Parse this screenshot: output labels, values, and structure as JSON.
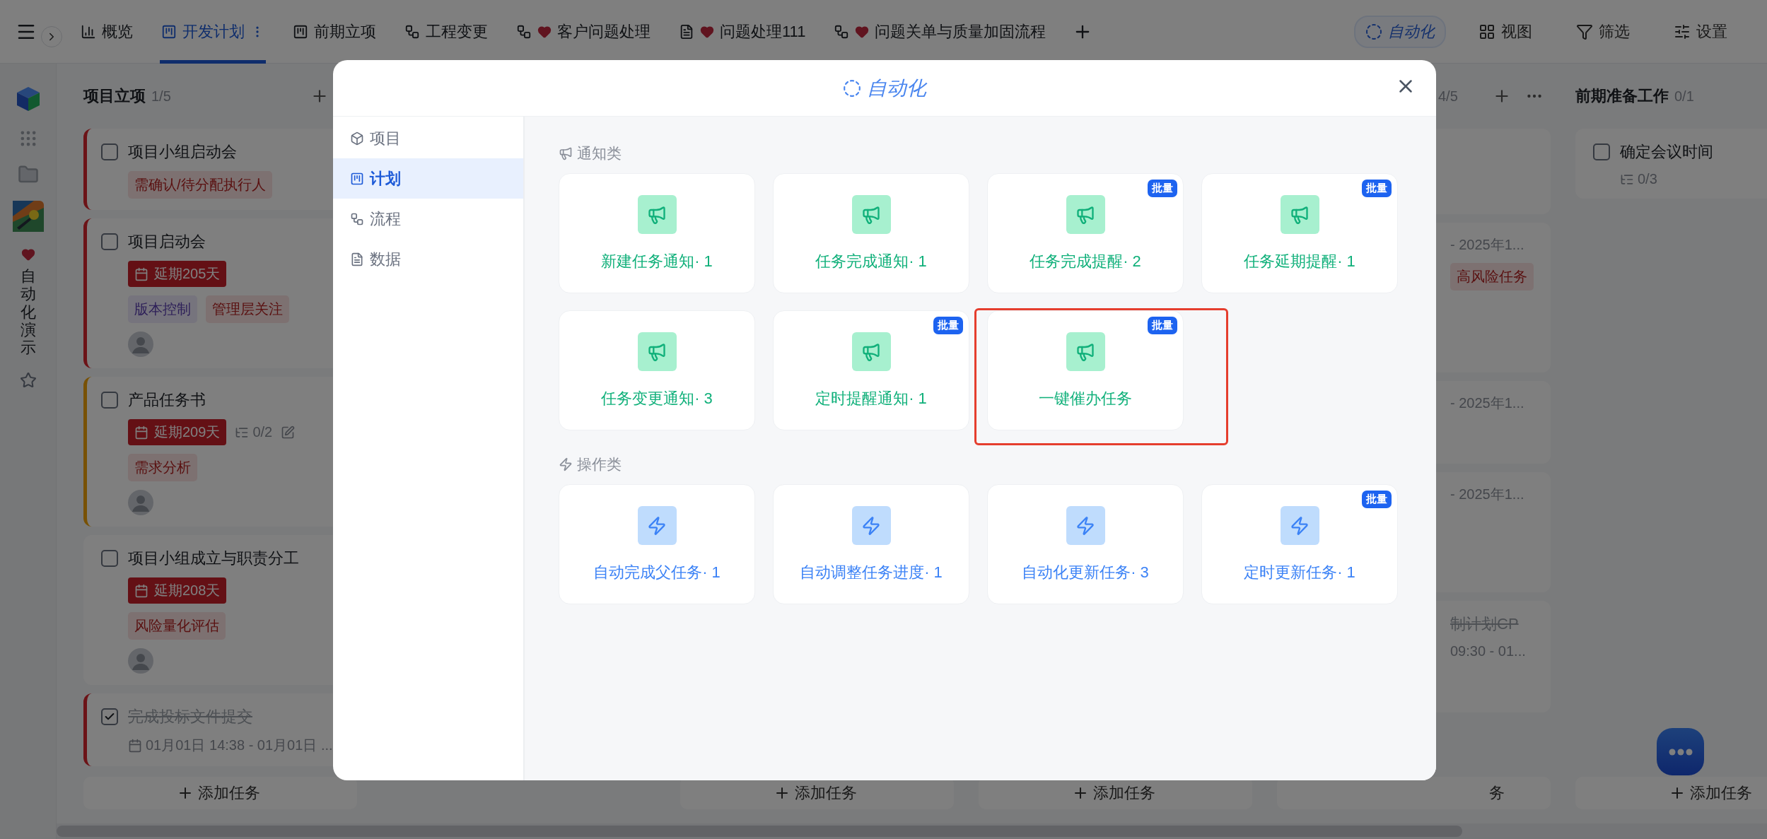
{
  "tabs": [
    {
      "label": "概览",
      "favorite": false,
      "selected": false
    },
    {
      "label": "开发计划",
      "favorite": false,
      "selected": true
    },
    {
      "label": "前期立项",
      "favorite": false,
      "selected": false
    },
    {
      "label": "工程变更",
      "favorite": false,
      "selected": false
    },
    {
      "label": "客户问题处理",
      "favorite": true,
      "selected": false
    },
    {
      "label": "问题处理111",
      "favorite": true,
      "selected": false
    },
    {
      "label": "问题关单与质量加固流程",
      "favorite": true,
      "selected": false
    }
  ],
  "toolbar": [
    {
      "label": "自动化",
      "selected": true
    },
    {
      "label": "视图",
      "selected": false
    },
    {
      "label": "筛选",
      "selected": false
    },
    {
      "label": "设置",
      "selected": false
    }
  ],
  "rail": {
    "app_name": "自动化演示",
    "favorite": true
  },
  "columns": [
    {
      "kind": "full",
      "title": "项目立项",
      "count": "1/5",
      "add_label": "添加任务",
      "cards": [
        {
          "title": "项目小组启动会",
          "kind": "high",
          "done": false,
          "tags": [
            {
              "label": "需确认/待分配执行人",
              "kind": "alert"
            }
          ]
        },
        {
          "title": "项目启动会",
          "kind": "high",
          "done": false,
          "delay": "延期205天",
          "tags": [
            {
              "label": "版本控制",
              "kind": "info"
            },
            {
              "label": "管理层关注",
              "kind": "alert"
            }
          ],
          "avatar": true
        },
        {
          "title": "产品任务书",
          "kind": "medium",
          "done": false,
          "delay": "延期209天",
          "subtasks": "0/2",
          "editable": true,
          "tags": [
            {
              "label": "需求分析",
              "kind": "alert"
            }
          ],
          "avatar": true
        },
        {
          "title": "项目小组成立与职责分工",
          "kind": "plain",
          "done": false,
          "delay": "延期208天",
          "tags": [
            {
              "label": "风险量化评估",
              "kind": "alert"
            }
          ],
          "avatar": true
        },
        {
          "title": "完成投标文件提交",
          "kind": "high",
          "done": true,
          "date": "01月01日 14:38 - 01月01日 ..."
        }
      ]
    },
    {
      "kind": "covered"
    },
    {
      "kind": "covered",
      "add_label": "添加任务"
    },
    {
      "kind": "covered",
      "add_label": "添加任务"
    },
    {
      "kind": "partial",
      "count": "4/5",
      "add_label": "务",
      "cards": [
        {
          "date": "- 2025年1...",
          "tags": [
            {
              "label": "高风险任务",
              "kind": "alert"
            }
          ]
        },
        {
          "date": "- 2025年1..."
        },
        {
          "date": "- 2025年1..."
        },
        {
          "title": "制计划CP",
          "done": true,
          "date": "09:30 - 01..."
        }
      ]
    },
    {
      "kind": "full",
      "title": "前期准备工作",
      "count": "0/1",
      "add_label": "添加任务",
      "cards": [
        {
          "title": "确定会议时间",
          "kind": "plain",
          "done": false,
          "subtasks": "0/3"
        }
      ]
    }
  ],
  "modal": {
    "title": "自动化",
    "nav": [
      {
        "label": "项目",
        "selected": false
      },
      {
        "label": "计划",
        "selected": true
      },
      {
        "label": "流程",
        "selected": false
      },
      {
        "label": "数据",
        "selected": false
      }
    ],
    "sections": [
      {
        "title": "通知类",
        "kind": "notify",
        "items": [
          {
            "label": "新建任务通知· 1",
            "highlighted": false
          },
          {
            "label": "任务完成通知· 1",
            "highlighted": false
          },
          {
            "label": "任务完成提醒· 2",
            "badge": "批量",
            "highlighted": false
          },
          {
            "label": "任务延期提醒· 1",
            "badge": "批量",
            "highlighted": false
          },
          {
            "label": "任务变更通知· 3",
            "highlighted": false
          },
          {
            "label": "定时提醒通知· 1",
            "badge": "批量",
            "highlighted": false
          },
          {
            "label": "一键催办任务",
            "badge": "批量",
            "highlighted": true
          }
        ]
      },
      {
        "title": "操作类",
        "kind": "action",
        "items": [
          {
            "label": "自动完成父任务· 1",
            "highlighted": false
          },
          {
            "label": "自动调整任务进度· 1",
            "highlighted": false
          },
          {
            "label": "自动化更新任务· 3",
            "highlighted": false
          },
          {
            "label": "定时更新任务· 1",
            "badge": "批量",
            "highlighted": false
          }
        ]
      }
    ]
  }
}
